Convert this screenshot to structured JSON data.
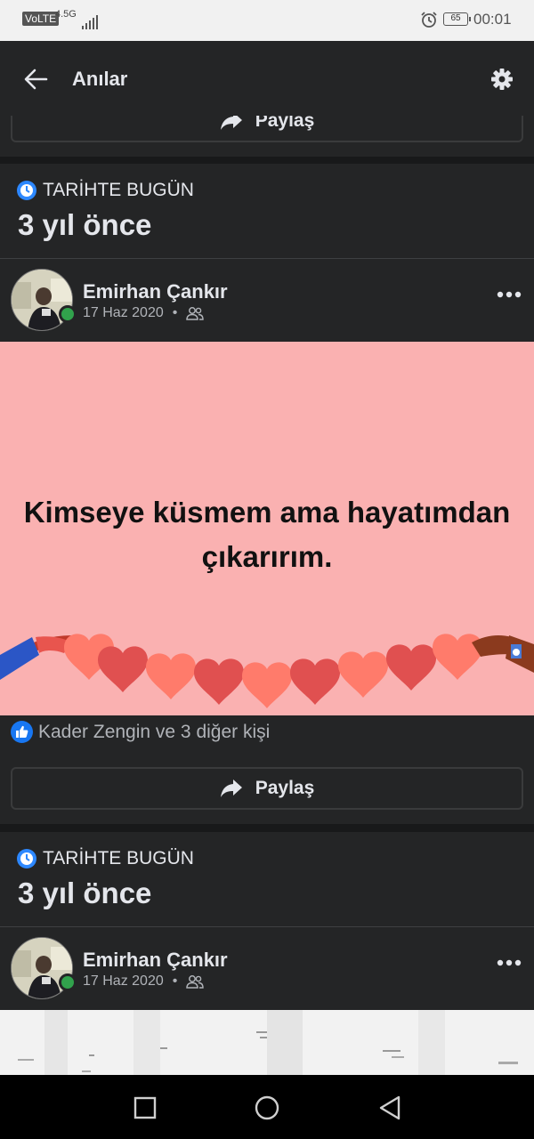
{
  "status_bar": {
    "volte": "VoLTE",
    "network": "4.5G",
    "battery": "65",
    "time": "00:01"
  },
  "header": {
    "title": "Anılar"
  },
  "share_label": "Paylaş",
  "memories": [
    {
      "label": "TARİHTE BUGÜN",
      "years_ago": "3 yıl önce",
      "post": {
        "author": "Emirhan Çankır",
        "date": "17 Haz 2020",
        "separator": "•",
        "text": "Kimseye küsmem ama hayatımdan çıkarırım.",
        "reactions": "Kader Zengin ve 3 diğer kişi"
      }
    },
    {
      "label": "TARİHTE BUGÜN",
      "years_ago": "3 yıl önce",
      "post": {
        "author": "Emirhan Çankır",
        "date": "17 Haz 2020",
        "separator": "•"
      }
    }
  ],
  "colors": {
    "background": "#18191a",
    "card": "#242526",
    "post_background": "#fab1b1",
    "hearts_dark": "#e05050",
    "hearts_light": "#ff7b6b",
    "online": "#31a24c",
    "like": "#1877f2"
  },
  "icons": [
    "back-arrow-icon",
    "gear-icon",
    "share-arrow-icon",
    "clock-memory-icon",
    "friends-audience-icon",
    "more-options-icon",
    "like-icon"
  ]
}
